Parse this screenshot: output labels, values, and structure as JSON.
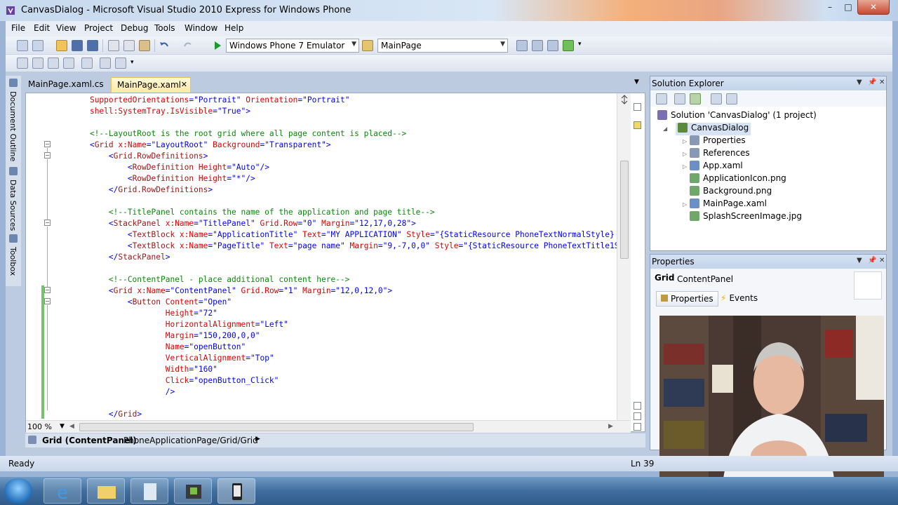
{
  "window": {
    "title": "CanvasDialog - Microsoft Visual Studio 2010 Express for Windows Phone",
    "minimize": "–",
    "maximize": "□",
    "close": "✕"
  },
  "menu": [
    "File",
    "Edit",
    "View",
    "Project",
    "Debug",
    "Tools",
    "Window",
    "Help"
  ],
  "toolbar": {
    "target_device": "Windows Phone 7 Emulator",
    "startup_page": "MainPage"
  },
  "side_rail": [
    "Document Outline",
    "Data Sources",
    "Toolbox"
  ],
  "tabs": [
    {
      "label": "MainPage.xaml.cs",
      "active": false
    },
    {
      "label": "MainPage.xaml",
      "active": true,
      "close": "✕"
    }
  ],
  "editor": {
    "zoom": "100 %",
    "lines": [
      [
        [
          "n",
          "    "
        ],
        [
          "a",
          "SupportedOrientations"
        ],
        [
          "p",
          "=\""
        ],
        [
          "v",
          "Portrait"
        ],
        [
          "p",
          "\" "
        ],
        [
          "a",
          "Orientation"
        ],
        [
          "p",
          "=\""
        ],
        [
          "v",
          "Portrait"
        ],
        [
          "p",
          "\""
        ]
      ],
      [
        [
          "n",
          "    "
        ],
        [
          "a",
          "shell:SystemTray.IsVisible"
        ],
        [
          "p",
          "=\""
        ],
        [
          "v",
          "True"
        ],
        [
          "p",
          "\">"
        ]
      ],
      [],
      [
        [
          "c",
          "    <!--LayoutRoot is the root grid where all page content is placed-->"
        ]
      ],
      [
        [
          "p",
          "    <"
        ],
        [
          "t",
          "Grid "
        ],
        [
          "a",
          "x:Name"
        ],
        [
          "p",
          "=\""
        ],
        [
          "v",
          "LayoutRoot"
        ],
        [
          "p",
          "\" "
        ],
        [
          "a",
          "Background"
        ],
        [
          "p",
          "=\""
        ],
        [
          "v",
          "Transparent"
        ],
        [
          "p",
          "\">"
        ]
      ],
      [
        [
          "p",
          "        <"
        ],
        [
          "t",
          "Grid.RowDefinitions"
        ],
        [
          "p",
          ">"
        ]
      ],
      [
        [
          "p",
          "            <"
        ],
        [
          "t",
          "RowDefinition "
        ],
        [
          "a",
          "Height"
        ],
        [
          "p",
          "=\""
        ],
        [
          "v",
          "Auto"
        ],
        [
          "p",
          "\"/>"
        ]
      ],
      [
        [
          "p",
          "            <"
        ],
        [
          "t",
          "RowDefinition "
        ],
        [
          "a",
          "Height"
        ],
        [
          "p",
          "=\""
        ],
        [
          "v",
          "*"
        ],
        [
          "p",
          "\"/>"
        ]
      ],
      [
        [
          "p",
          "        </"
        ],
        [
          "t",
          "Grid.RowDefinitions"
        ],
        [
          "p",
          ">"
        ]
      ],
      [],
      [
        [
          "c",
          "        <!--TitlePanel contains the name of the application and page title-->"
        ]
      ],
      [
        [
          "p",
          "        <"
        ],
        [
          "t",
          "StackPanel "
        ],
        [
          "a",
          "x:Name"
        ],
        [
          "p",
          "=\""
        ],
        [
          "v",
          "TitlePanel"
        ],
        [
          "p",
          "\" "
        ],
        [
          "a",
          "Grid.Row"
        ],
        [
          "p",
          "=\""
        ],
        [
          "v",
          "0"
        ],
        [
          "p",
          "\" "
        ],
        [
          "a",
          "Margin"
        ],
        [
          "p",
          "=\""
        ],
        [
          "v",
          "12,17,0,28"
        ],
        [
          "p",
          "\">"
        ]
      ],
      [
        [
          "p",
          "            <"
        ],
        [
          "t",
          "TextBlock "
        ],
        [
          "a",
          "x:Name"
        ],
        [
          "p",
          "=\""
        ],
        [
          "v",
          "ApplicationTitle"
        ],
        [
          "p",
          "\" "
        ],
        [
          "a",
          "Text"
        ],
        [
          "p",
          "=\""
        ],
        [
          "v",
          "MY APPLICATION"
        ],
        [
          "p",
          "\" "
        ],
        [
          "a",
          "Style"
        ],
        [
          "p",
          "=\""
        ],
        [
          "v",
          "{StaticResource PhoneTextNormalStyle}"
        ]
      ],
      [
        [
          "p",
          "            <"
        ],
        [
          "t",
          "TextBlock "
        ],
        [
          "a",
          "x:Name"
        ],
        [
          "p",
          "=\""
        ],
        [
          "v",
          "PageTitle"
        ],
        [
          "p",
          "\" "
        ],
        [
          "a",
          "Text"
        ],
        [
          "p",
          "=\""
        ],
        [
          "v",
          "page name"
        ],
        [
          "p",
          "\" "
        ],
        [
          "a",
          "Margin"
        ],
        [
          "p",
          "=\""
        ],
        [
          "v",
          "9,-7,0,0"
        ],
        [
          "p",
          "\" "
        ],
        [
          "a",
          "Style"
        ],
        [
          "p",
          "=\""
        ],
        [
          "v",
          "{StaticResource PhoneTextTitle1S"
        ]
      ],
      [
        [
          "p",
          "        </"
        ],
        [
          "t",
          "StackPanel"
        ],
        [
          "p",
          ">"
        ]
      ],
      [],
      [
        [
          "c",
          "        <!--ContentPanel - place additional content here-->"
        ]
      ],
      [
        [
          "p",
          "        <"
        ],
        [
          "t",
          "Grid "
        ],
        [
          "a",
          "x:Name"
        ],
        [
          "p",
          "=\""
        ],
        [
          "v",
          "ContentPanel"
        ],
        [
          "p",
          "\" "
        ],
        [
          "a",
          "Grid.Row"
        ],
        [
          "p",
          "=\""
        ],
        [
          "v",
          "1"
        ],
        [
          "p",
          "\" "
        ],
        [
          "a",
          "Margin"
        ],
        [
          "p",
          "=\""
        ],
        [
          "v",
          "12,0,12,0"
        ],
        [
          "p",
          "\">"
        ]
      ],
      [
        [
          "p",
          "            <"
        ],
        [
          "t",
          "Button "
        ],
        [
          "a",
          "Content"
        ],
        [
          "p",
          "=\""
        ],
        [
          "v",
          "Open"
        ],
        [
          "p",
          "\""
        ]
      ],
      [
        [
          "n",
          "                    "
        ],
        [
          "a",
          "Height"
        ],
        [
          "p",
          "=\""
        ],
        [
          "v",
          "72"
        ],
        [
          "p",
          "\""
        ]
      ],
      [
        [
          "n",
          "                    "
        ],
        [
          "a",
          "HorizontalAlignment"
        ],
        [
          "p",
          "=\""
        ],
        [
          "v",
          "Left"
        ],
        [
          "p",
          "\""
        ]
      ],
      [
        [
          "n",
          "                    "
        ],
        [
          "a",
          "Margin"
        ],
        [
          "p",
          "=\""
        ],
        [
          "v",
          "150,200,0,0"
        ],
        [
          "p",
          "\""
        ]
      ],
      [
        [
          "n",
          "                    "
        ],
        [
          "a",
          "Name"
        ],
        [
          "p",
          "=\""
        ],
        [
          "v",
          "openButton"
        ],
        [
          "p",
          "\""
        ]
      ],
      [
        [
          "n",
          "                    "
        ],
        [
          "a",
          "VerticalAlignment"
        ],
        [
          "p",
          "=\""
        ],
        [
          "v",
          "Top"
        ],
        [
          "p",
          "\""
        ]
      ],
      [
        [
          "n",
          "                    "
        ],
        [
          "a",
          "Width"
        ],
        [
          "p",
          "=\""
        ],
        [
          "v",
          "160"
        ],
        [
          "p",
          "\""
        ]
      ],
      [
        [
          "n",
          "                    "
        ],
        [
          "a",
          "Click"
        ],
        [
          "p",
          "=\""
        ],
        [
          "v",
          "openButton_Click"
        ],
        [
          "p",
          "\""
        ]
      ],
      [
        [
          "p",
          "                    />"
        ]
      ],
      [],
      [
        [
          "p",
          "        </"
        ],
        [
          "t",
          "Grid"
        ],
        [
          "p",
          ">"
        ]
      ]
    ]
  },
  "breadcrumb": {
    "element": "Grid (ContentPanel)",
    "path": "PhoneApplicationPage/Grid/Grid"
  },
  "solution_explorer": {
    "title": "Solution Explorer",
    "items": [
      {
        "label": "Solution 'CanvasDialog' (1 project)",
        "indent": 0,
        "icon": "solution-icon"
      },
      {
        "label": "CanvasDialog",
        "indent": 1,
        "icon": "project-icon",
        "bold": true
      },
      {
        "label": "Properties",
        "indent": 2,
        "icon": "properties-icon"
      },
      {
        "label": "References",
        "indent": 2,
        "icon": "references-icon"
      },
      {
        "label": "App.xaml",
        "indent": 2,
        "icon": "xaml-file-icon"
      },
      {
        "label": "ApplicationIcon.png",
        "indent": 2,
        "icon": "image-file-icon"
      },
      {
        "label": "Background.png",
        "indent": 2,
        "icon": "image-file-icon"
      },
      {
        "label": "MainPage.xaml",
        "indent": 2,
        "icon": "xaml-file-icon"
      },
      {
        "label": "SplashScreenImage.jpg",
        "indent": 2,
        "icon": "image-file-icon"
      }
    ]
  },
  "properties": {
    "title": "Properties",
    "element_type": "Grid",
    "element_name": "ContentPanel",
    "tab_properties": "Properties",
    "tab_events": "Events"
  },
  "status": {
    "ready": "Ready",
    "line": "Ln 39"
  },
  "colors": {
    "comment": "#0a8a0a",
    "tag": "#a31515",
    "attribute": "#e00000",
    "value": "#0000ff"
  }
}
